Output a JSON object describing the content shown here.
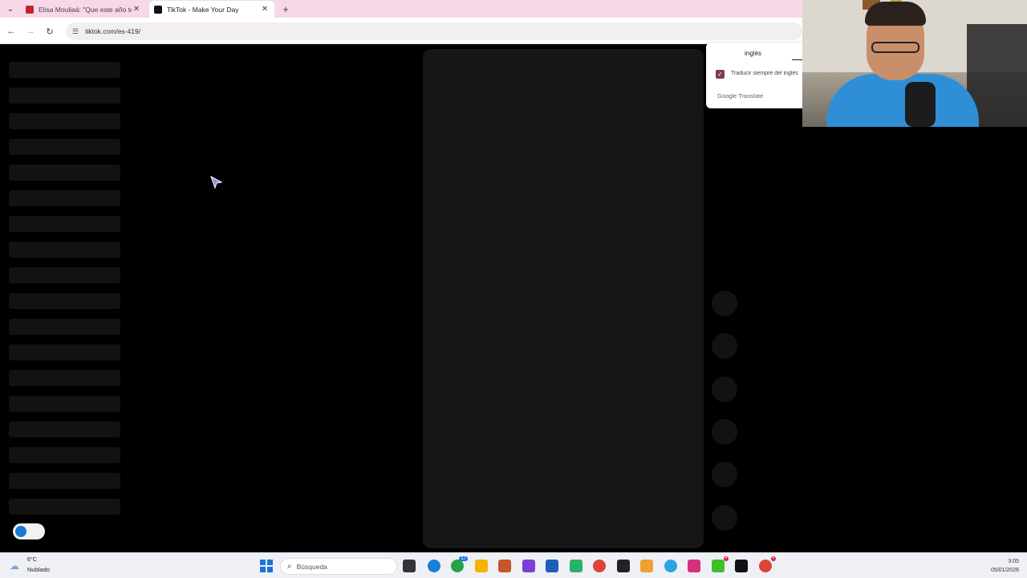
{
  "browser": {
    "tabs": [
      {
        "title": "Elisa Mouliaá: \"Que este año te",
        "favicon_color": "#c3262a",
        "active": false
      },
      {
        "title": "TikTok - Make Your Day",
        "favicon_color": "#111111",
        "active": true
      }
    ],
    "new_tab_label": "+",
    "url": "tiktok.com/es-419/"
  },
  "translate_popup": {
    "language": "inglés",
    "always_translate_label": "Traducir siempre del inglés",
    "always_translate_checked": true,
    "brand": "Google Translate"
  },
  "taskbar": {
    "weather": {
      "temp": "6°C",
      "desc": "Nublado"
    },
    "search_placeholder": "Búsqueda",
    "apps": [
      {
        "name": "task-view-icon",
        "color": "#333333"
      },
      {
        "name": "edge-icon",
        "color": "#1a7fd6"
      },
      {
        "name": "whatsapp-icon",
        "color": "#25a244",
        "badge": "17"
      },
      {
        "name": "file-explorer-icon",
        "color": "#f2b400"
      },
      {
        "name": "app-icon",
        "color": "#c4572a"
      },
      {
        "name": "clipchamp-icon",
        "color": "#7b3fd6"
      },
      {
        "name": "store-icon",
        "color": "#1e5fb8"
      },
      {
        "name": "app-icon",
        "color": "#2ab06a"
      },
      {
        "name": "chrome-icon",
        "color": "#db4437"
      },
      {
        "name": "app-icon",
        "color": "#222222"
      },
      {
        "name": "rtve-icon",
        "color": "#f0a030"
      },
      {
        "name": "telegram-icon",
        "color": "#2aa3e0"
      },
      {
        "name": "instagram-icon",
        "color": "#d62f7c"
      },
      {
        "name": "kick-icon",
        "color": "#3fbf2a",
        "badge": "•"
      },
      {
        "name": "tiktok-icon",
        "color": "#111111"
      },
      {
        "name": "chrome-icon",
        "color": "#db4437",
        "badge": "•"
      }
    ],
    "time": "3:05",
    "date": "05/01/2026"
  }
}
